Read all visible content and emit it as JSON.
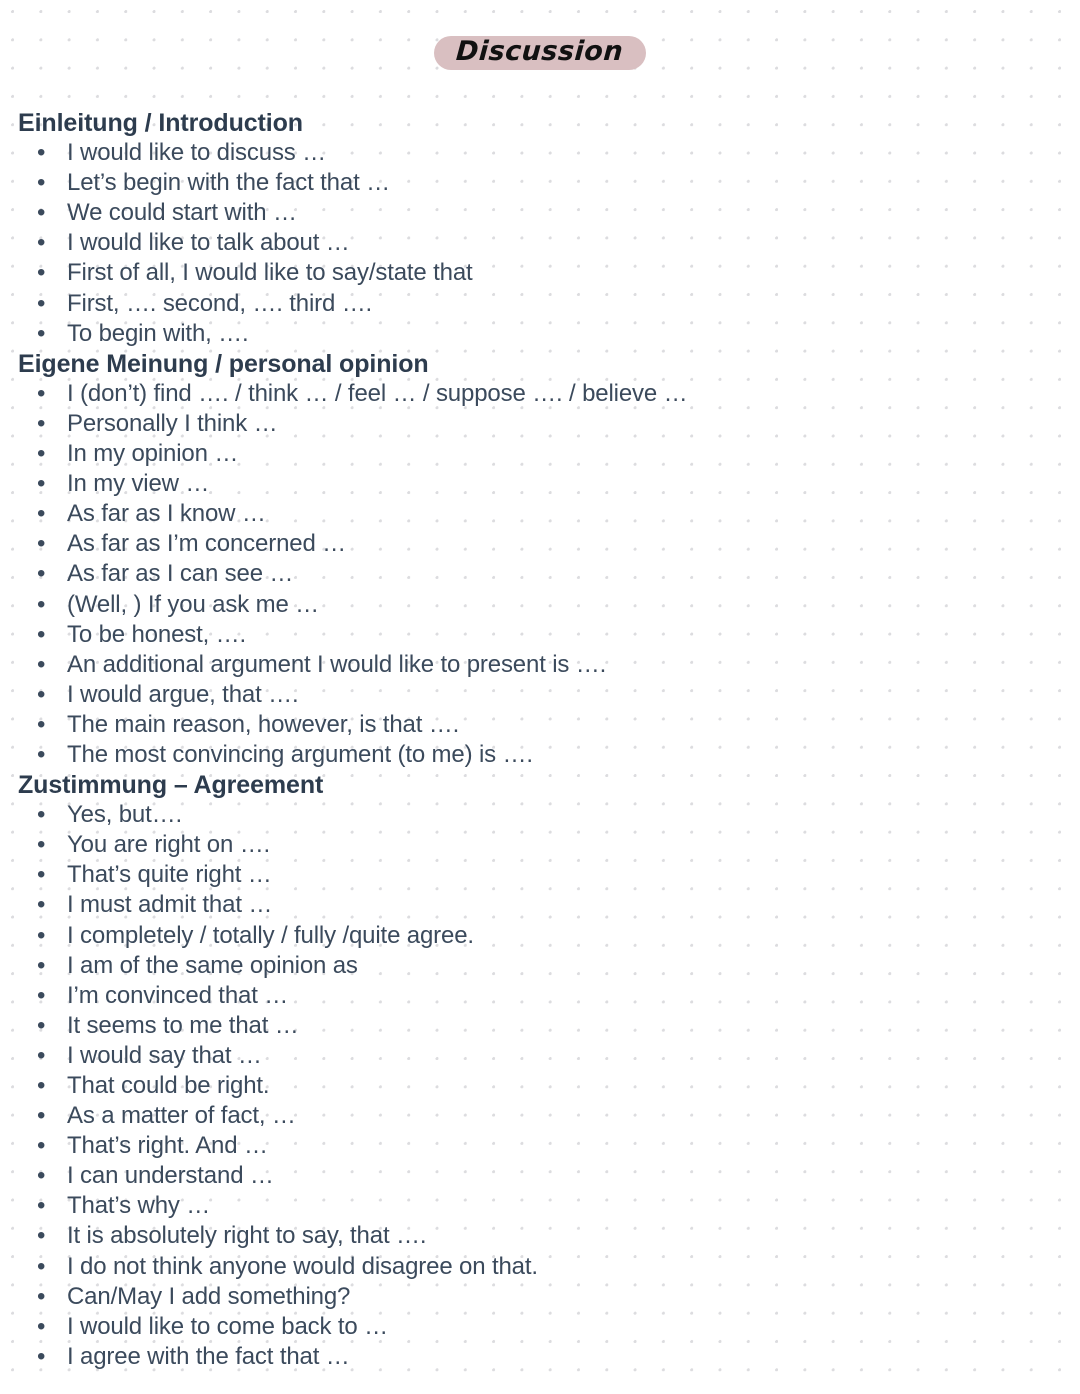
{
  "page": {
    "title": "Discussion",
    "title_highlight_color": "#d9bfc1",
    "text_color": "#3b4a5c",
    "heading_color": "#2d3c4e",
    "background_color": "#ffffff",
    "grid_dot_color": "#dcdcdf",
    "bullet_glyph": "•"
  },
  "sections": [
    {
      "heading": "Einleitung / Introduction",
      "items": [
        "I would like to discuss …",
        "Let’s begin with the fact that …",
        "We could start with …",
        "I would like to talk about …",
        "First of all, I would like to say/state that",
        "First, …. second, …. third ….",
        "To begin with, …."
      ]
    },
    {
      "heading": "Eigene Meinung / personal opinion",
      "items": [
        "I (don’t) find …. / think … / feel … / suppose …. / believe …",
        "Personally I think …",
        "In my opinion …",
        "In my view …",
        "As far as I know …",
        "As far as I’m concerned …",
        "As far as I can see …",
        "(Well, ) If you ask me …",
        "To be honest, ….",
        "An additional argument I would like to present is ….",
        "I would argue, that ….",
        "The main reason, however, is that ….",
        "The most convincing argument (to me) is …."
      ]
    },
    {
      "heading": "Zustimmung – Agreement",
      "items": [
        "Yes, but….",
        "You are right on ….",
        "That’s quite right …",
        "I must admit that …",
        "I completely / totally / fully /quite agree.",
        "I am of the same opinion as",
        "I’m convinced that …",
        "It seems to me that …",
        "I would say that …",
        "That could be right.",
        "As a matter of fact, …",
        "That’s right. And …",
        "I can understand …",
        "That’s why …",
        "It is absolutely right to say, that ….",
        "I do not think anyone would disagree on that.",
        "Can/May I add something?",
        "I would like to come back to …",
        "I agree with the fact that …"
      ]
    }
  ]
}
